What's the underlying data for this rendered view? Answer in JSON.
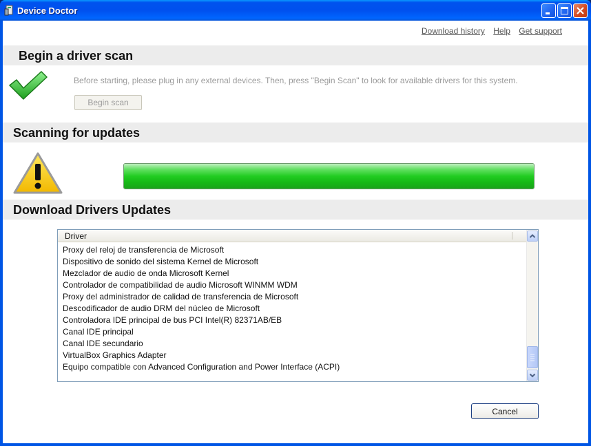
{
  "window": {
    "title": "Device Doctor",
    "icon": "device-doctor-app-icon"
  },
  "links": {
    "download_history": "Download history",
    "help": "Help",
    "get_support": "Get support"
  },
  "scan_section": {
    "heading": "Begin a driver scan",
    "instruction": "Before starting, please plug in any external devices. Then, press \"Begin Scan\" to look for available drivers for this system.",
    "button": "Begin scan",
    "icon": "green-checkmark-icon"
  },
  "updates_section": {
    "heading": "Scanning for updates",
    "icon": "warning-triangle-icon",
    "progress": 1.0,
    "accent": "#22cc22"
  },
  "drivers_section": {
    "heading": "Download Drivers Updates",
    "column": "Driver",
    "rows": [
      "Proxy del reloj de transferencia de Microsoft",
      "Dispositivo de sonido del sistema Kernel de Microsoft",
      "Mezclador de audio de onda Microsoft Kernel",
      "Controlador de compatibilidad de audio Microsoft WINMM WDM",
      "Proxy del administrador de calidad de transferencia de Microsoft",
      "Descodificador de audio DRM del núcleo de Microsoft",
      "Controladora IDE principal de bus PCI Intel(R) 82371AB/EB",
      "Canal IDE principal",
      "Canal IDE secundario",
      "VirtualBox Graphics Adapter",
      "Equipo compatible con Advanced Configuration and Power Interface (ACPI)"
    ]
  },
  "footer": {
    "cancel": "Cancel"
  },
  "colors": {
    "titlebar": "#0053ee",
    "section_bg": "#ececec",
    "progress_green": "#22cc22"
  }
}
